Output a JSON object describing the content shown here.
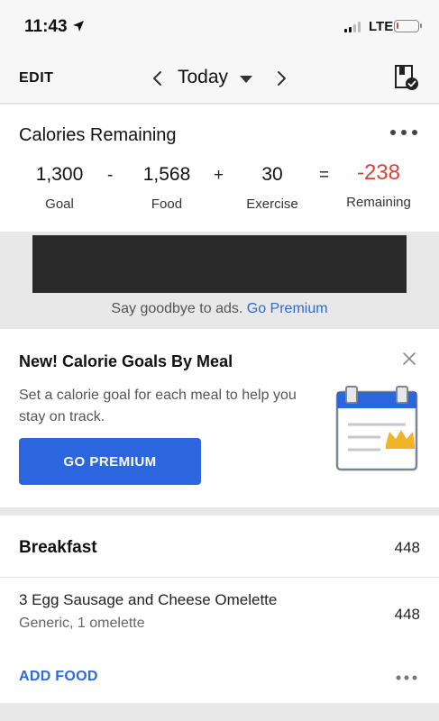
{
  "status_bar": {
    "time": "11:43",
    "network": "LTE",
    "battery_level": 0.1,
    "battery_color": "#e0453a"
  },
  "nav": {
    "edit_label": "EDIT",
    "date_label": "Today"
  },
  "calories": {
    "title": "Calories Remaining",
    "goal": {
      "value": "1,300",
      "label": "Goal"
    },
    "op_minus": "-",
    "food": {
      "value": "1,568",
      "label": "Food"
    },
    "op_plus": "+",
    "exercise": {
      "value": "30",
      "label": "Exercise"
    },
    "op_equals": "=",
    "remaining": {
      "value": "-238",
      "label": "Remaining"
    },
    "remaining_color": "#d9433a"
  },
  "ad": {
    "text": "Say goodbye to ads.",
    "link": "Go Premium"
  },
  "promo": {
    "title": "New! Calorie Goals By Meal",
    "description": "Set a calorie goal for each meal to help you stay on track.",
    "button_label": "GO PREMIUM",
    "button_color": "#2c66de"
  },
  "meal": {
    "title": "Breakfast",
    "calories": "448",
    "foods": [
      {
        "name": "3 Egg Sausage and Cheese Omelette",
        "detail": "Generic, 1 omelette",
        "calories": "448"
      }
    ],
    "add_food_label": "ADD FOOD"
  },
  "icons": {
    "location": "location-arrow-icon",
    "signal": "cellular-signal-icon",
    "battery": "battery-icon",
    "prev": "chevron-left-icon",
    "dropdown": "caret-down-icon",
    "next": "chevron-right-icon",
    "diary": "diary-complete-icon",
    "more": "more-horizontal-icon",
    "close": "close-icon",
    "calendar": "calendar-crown-icon"
  }
}
